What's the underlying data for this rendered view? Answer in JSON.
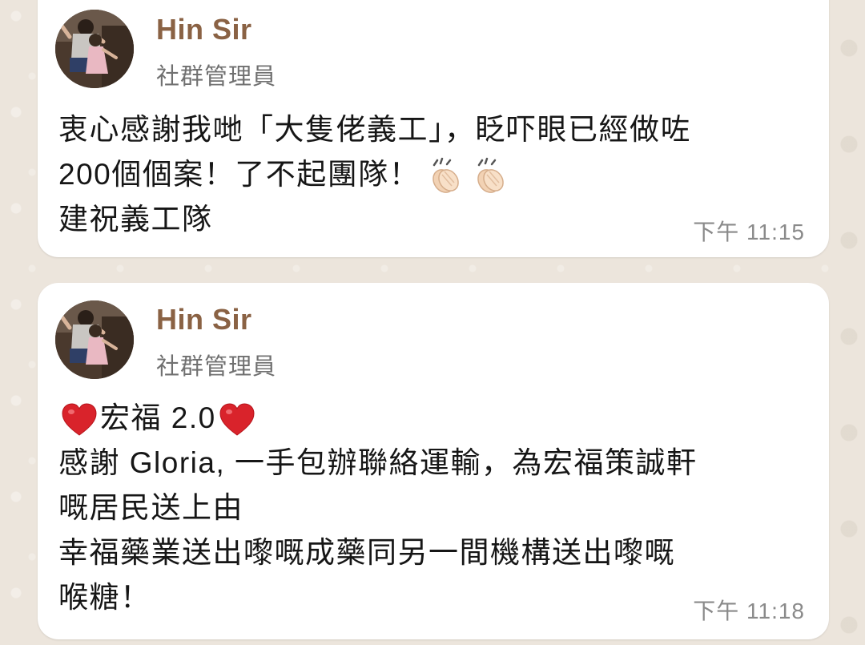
{
  "messages": [
    {
      "sender": "Hin Sir",
      "role": "社群管理員",
      "lines": [
        "衷心感謝我哋「大隻佬義工」，眨吓眼已經做咗",
        "200個個案！了不起團隊！",
        "建祝義工隊"
      ],
      "emoji": [
        "clap-icon",
        "clap-icon"
      ],
      "time": "下午 11:15"
    },
    {
      "sender": "Hin Sir",
      "role": "社群管理員",
      "lines": [
        "宏福 2.0",
        "感謝 Gloria, 一手包辦聯絡運輸，為宏福策誠軒",
        "嘅居民送上由",
        "幸福藥業送出嚟嘅成藥同另一間機構送出嚟嘅",
        "喉糖！"
      ],
      "emoji": [
        "heart-icon",
        "heart-icon"
      ],
      "time": "下午 11:18"
    }
  ],
  "colors": {
    "wallpaper": "#ece5dc",
    "bubble": "#ffffff",
    "sender": "#8a6244",
    "role": "#707070",
    "text": "#161616",
    "time": "#8a8a8a",
    "heart": "#d9232b"
  }
}
